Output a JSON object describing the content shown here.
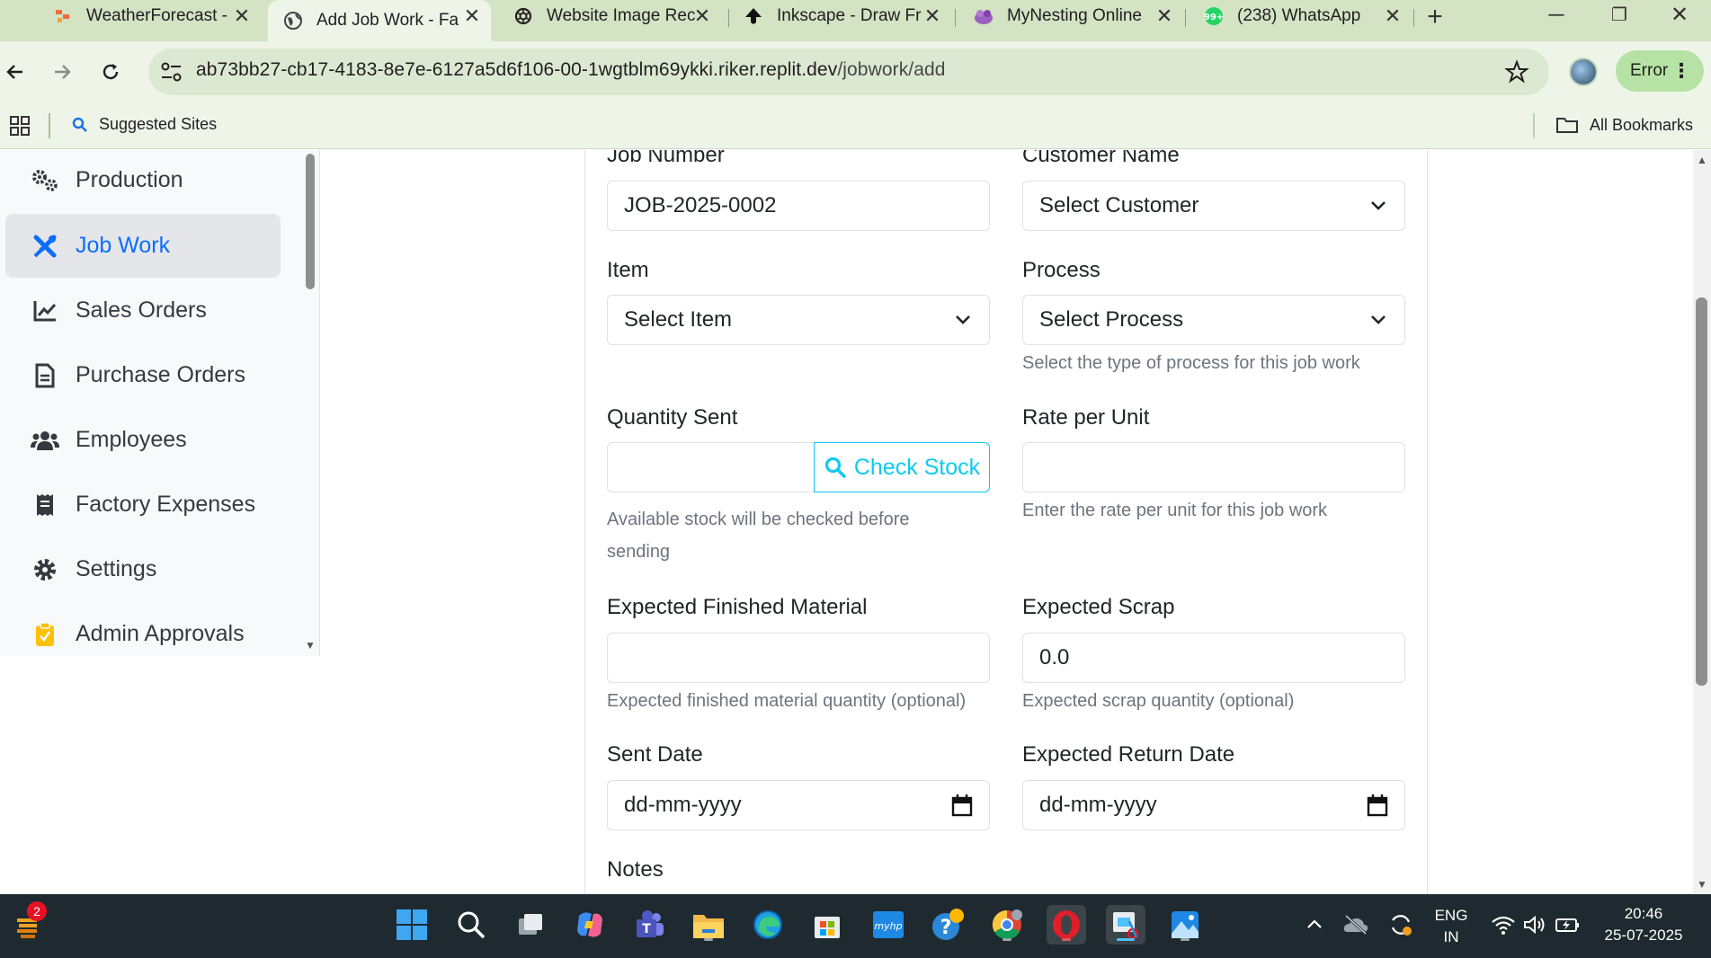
{
  "browser": {
    "tabs": [
      {
        "title": "WeatherForecast -",
        "icon": "weather-app-icon",
        "active": false
      },
      {
        "title": "Add Job Work - Fa",
        "icon": "globe-icon",
        "active": true
      },
      {
        "title": "Website Image Rec",
        "icon": "openai-icon",
        "active": false
      },
      {
        "title": "Inkscape - Draw Fr",
        "icon": "inkscape-icon",
        "active": false
      },
      {
        "title": "MyNesting Online",
        "icon": "mynesting-icon",
        "active": false
      },
      {
        "title": "(238) WhatsApp",
        "icon": "whatsapp-icon",
        "active": false
      }
    ],
    "url_host": "ab73bb27-cb17-4183-8e7e-6127a5d6f106-00-1wgtblm69ykki.riker.replit.dev",
    "url_path": "/jobwork/add",
    "error_label": "Error",
    "bookmarks": {
      "suggested": "Suggested Sites",
      "all": "All Bookmarks"
    }
  },
  "sidebar": {
    "items": [
      {
        "label": "Production",
        "icon": "gears-icon",
        "active": false
      },
      {
        "label": "Job Work",
        "icon": "tools-icon",
        "active": true
      },
      {
        "label": "Sales Orders",
        "icon": "chart-line-icon",
        "active": false
      },
      {
        "label": "Purchase Orders",
        "icon": "file-invoice-icon",
        "active": false
      },
      {
        "label": "Employees",
        "icon": "users-icon",
        "active": false
      },
      {
        "label": "Factory Expenses",
        "icon": "receipt-icon",
        "active": false
      },
      {
        "label": "Settings",
        "icon": "gear-icon",
        "active": false
      },
      {
        "label": "Admin Approvals",
        "icon": "clipboard-check-icon",
        "active": false
      }
    ]
  },
  "form": {
    "job_number": {
      "label": "Job Number",
      "value": "JOB-2025-0002"
    },
    "customer_name": {
      "label": "Customer Name",
      "value": "Select Customer"
    },
    "item": {
      "label": "Item",
      "value": "Select Item"
    },
    "process": {
      "label": "Process",
      "value": "Select Process",
      "help": "Select the type of process for this job work"
    },
    "quantity_sent": {
      "label": "Quantity Sent",
      "value": "",
      "button": "Check Stock",
      "help": "Available stock will be checked before sending"
    },
    "rate_per_unit": {
      "label": "Rate per Unit",
      "value": "",
      "help": "Enter the rate per unit for this job work"
    },
    "expected_finished": {
      "label": "Expected Finished Material",
      "value": "",
      "help": "Expected finished material quantity (optional)"
    },
    "expected_scrap": {
      "label": "Expected Scrap",
      "value": "0.0",
      "help": "Expected scrap quantity (optional)"
    },
    "sent_date": {
      "label": "Sent Date",
      "placeholder": "dd-mm-yyyy"
    },
    "expected_return_date": {
      "label": "Expected Return Date",
      "placeholder": "dd-mm-yyyy"
    },
    "notes": {
      "label": "Notes"
    }
  },
  "taskbar": {
    "notification_count": "2",
    "lang_line1": "ENG",
    "lang_line2": "IN",
    "time": "20:46",
    "date": "25-07-2025"
  }
}
